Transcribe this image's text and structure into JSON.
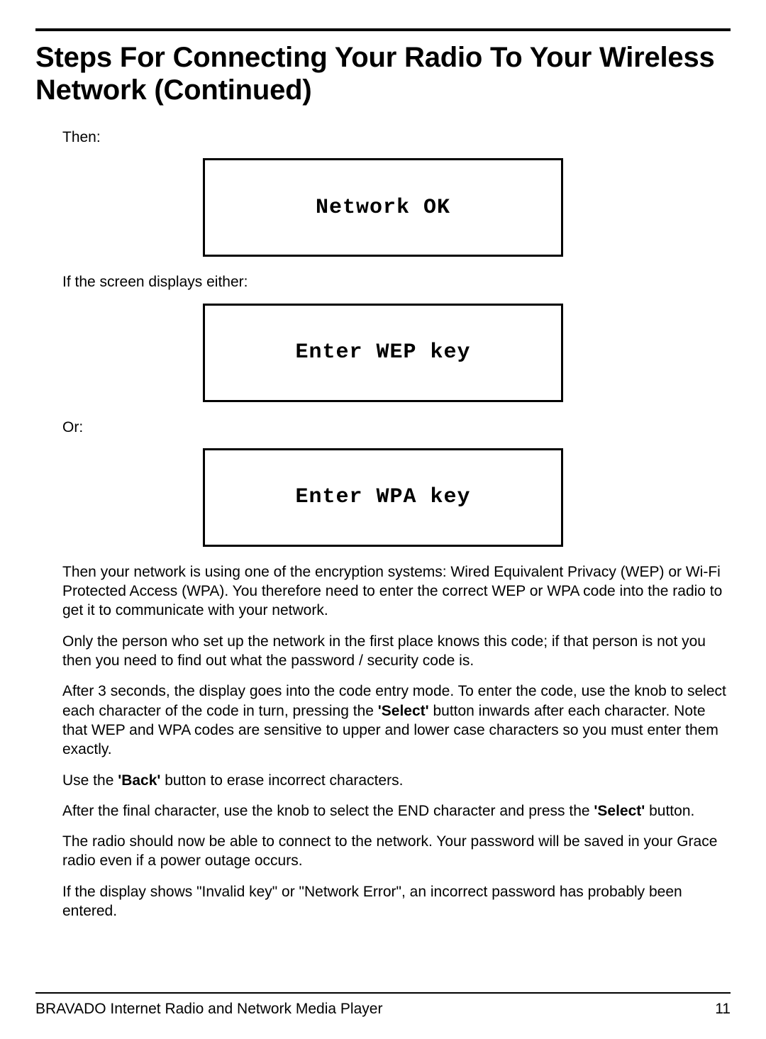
{
  "heading": "Steps For Connecting Your Radio To Your Wireless Network (Continued)",
  "p_then": "Then:",
  "screen1": "Network OK",
  "p_if": "If the screen displays either:",
  "screen2": "Enter WEP key",
  "p_or": "Or:",
  "screen3": "Enter WPA key",
  "p_encrypt": "Then your network is using one of the encryption systems:  Wired Equivalent Privacy (WEP) or Wi-Fi Protected Access (WPA). You therefore need to enter the correct WEP or WPA code into the radio to get it to communicate with your network.",
  "p_onlyperson": "Only the person who set up the network in the first place knows this code; if that person is not you then you need to find out what the password / security code is.",
  "p_after3_a": "After 3 seconds, the display goes into the code entry mode. To enter the code, use the knob to select each character of the code in turn, pressing the ",
  "bold_select1": "'Select'",
  "p_after3_b": " button inwards after each character. Note that WEP and WPA codes are sensitive to upper and lower case characters so you must enter them exactly.",
  "p_useback_a": "Use the ",
  "bold_back": "'Back'",
  "p_useback_b": " button to erase incorrect characters.",
  "p_final_a": "After the final character, use the knob to select the END character and press the ",
  "bold_select2": "'Select'",
  "p_final_b": " button.",
  "p_saved": "The radio should now be able to connect to the network. Your password will be saved in your Grace radio even if a power outage occurs.",
  "p_invalid": "If the display shows \"Invalid key\" or \"Network Error\", an incorrect password has probably been entered.",
  "footer_left": "BRAVADO Internet Radio and Network Media Player",
  "footer_right": "11"
}
